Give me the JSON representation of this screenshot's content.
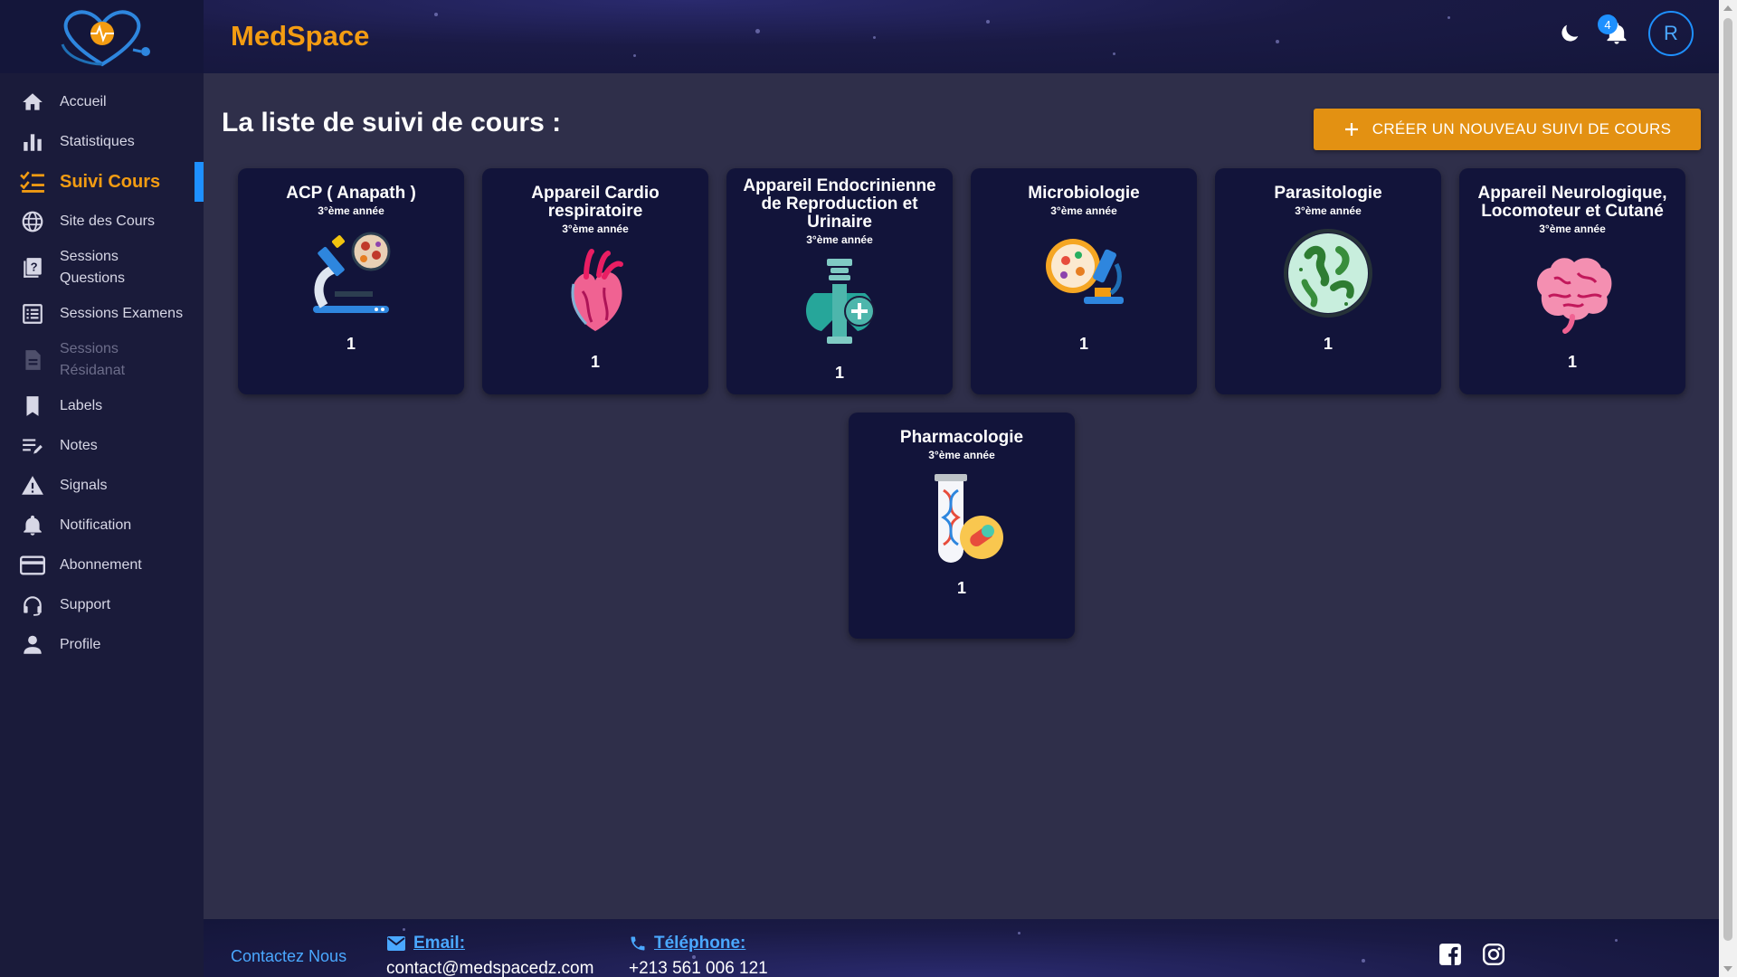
{
  "header": {
    "app_title": "MedSpace",
    "notification_count": "4",
    "avatar_initial": "R"
  },
  "sidebar": {
    "items": [
      {
        "label": "Accueil",
        "icon": "home-icon"
      },
      {
        "label": "Statistiques",
        "icon": "bar-chart-icon"
      },
      {
        "label": "Suivi Cours",
        "icon": "checklist-icon",
        "active": true
      },
      {
        "label": "Site des Cours",
        "icon": "globe-icon"
      },
      {
        "label": "Sessions Questions",
        "icon": "question-doc-icon"
      },
      {
        "label": "Sessions Examens",
        "icon": "list-icon"
      },
      {
        "label": "Sessions Résidanat",
        "icon": "doc-icon",
        "disabled": true
      },
      {
        "label": "Labels",
        "icon": "bookmark-icon"
      },
      {
        "label": "Notes",
        "icon": "notes-icon"
      },
      {
        "label": "Signals",
        "icon": "warning-icon"
      },
      {
        "label": "Notification",
        "icon": "bell-icon"
      },
      {
        "label": "Abonnement",
        "icon": "credit-card-icon"
      },
      {
        "label": "Support",
        "icon": "headset-icon"
      },
      {
        "label": "Profile",
        "icon": "person-icon"
      }
    ]
  },
  "main": {
    "page_title": "La liste de suivi de cours :",
    "create_button_label": "CRÉER UN NOUVEAU SUIVI DE COURS",
    "cards": [
      {
        "title": "ACP ( Anapath )",
        "year": "3°ème année",
        "count": "1",
        "icon": "microscope-icon"
      },
      {
        "title": "Appareil Cardio respiratoire",
        "year": "3°ème année",
        "count": "1",
        "icon": "heart-icon"
      },
      {
        "title": "Appareil Endocrinienne de Reproduction et Urinaire",
        "year": "3°ème année",
        "count": "1",
        "icon": "thyroid-icon"
      },
      {
        "title": "Microbiologie",
        "year": "3°ème année",
        "count": "1",
        "icon": "petri-microscope-icon"
      },
      {
        "title": "Parasitologie",
        "year": "3°ème année",
        "count": "1",
        "icon": "bacteria-icon"
      },
      {
        "title": "Appareil Neurologique, Locomoteur et Cutané",
        "year": "3°ème année",
        "count": "1",
        "icon": "brain-icon"
      },
      {
        "title": "Pharmacologie",
        "year": "3°ème année",
        "count": "1",
        "icon": "test-tube-pill-icon"
      }
    ]
  },
  "footer": {
    "contact_label": "Contactez Nous",
    "email_label": "Email:",
    "email_value": "contact@medspacedz.com",
    "phone_label": "Téléphone:",
    "phone_value": "+213 561 006 121"
  },
  "colors": {
    "accent": "#f39c12",
    "link": "#4aa8ff",
    "card_bg": "#12143a",
    "sidebar_bg": "#1a1b3a",
    "main_bg": "#2f2f4a"
  }
}
